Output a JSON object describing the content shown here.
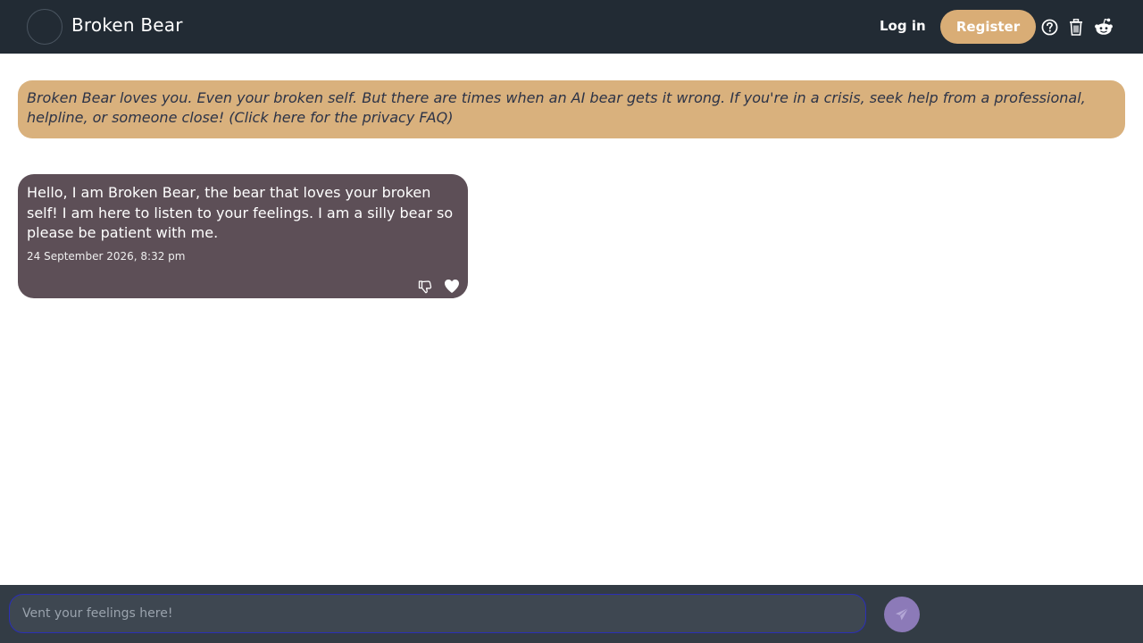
{
  "header": {
    "title": "Broken Bear",
    "login_label": "Log in",
    "register_label": "Register",
    "icons": [
      "help-icon",
      "trash-icon",
      "reddit-icon"
    ]
  },
  "disclaimer": {
    "text": "Broken Bear loves you. Even your broken self. But there are times when an AI bear gets it wrong. If you're in a crisis, seek help from a professional, helpline, or someone close! (Click here for the privacy FAQ)"
  },
  "messages": [
    {
      "text": "Hello, I am Broken Bear, the bear that loves your broken self! I am here to listen to your feelings. I am a silly bear so please be patient with me.",
      "timestamp": "24 September 2026, 8:32 pm"
    }
  ],
  "composer": {
    "placeholder": "Vent your feelings here!",
    "value": ""
  },
  "colors": {
    "header_bg": "#222b34",
    "accent": "#d9ad76",
    "bubble_bg": "#5d4f57",
    "send_button": "#8c7ab8"
  }
}
